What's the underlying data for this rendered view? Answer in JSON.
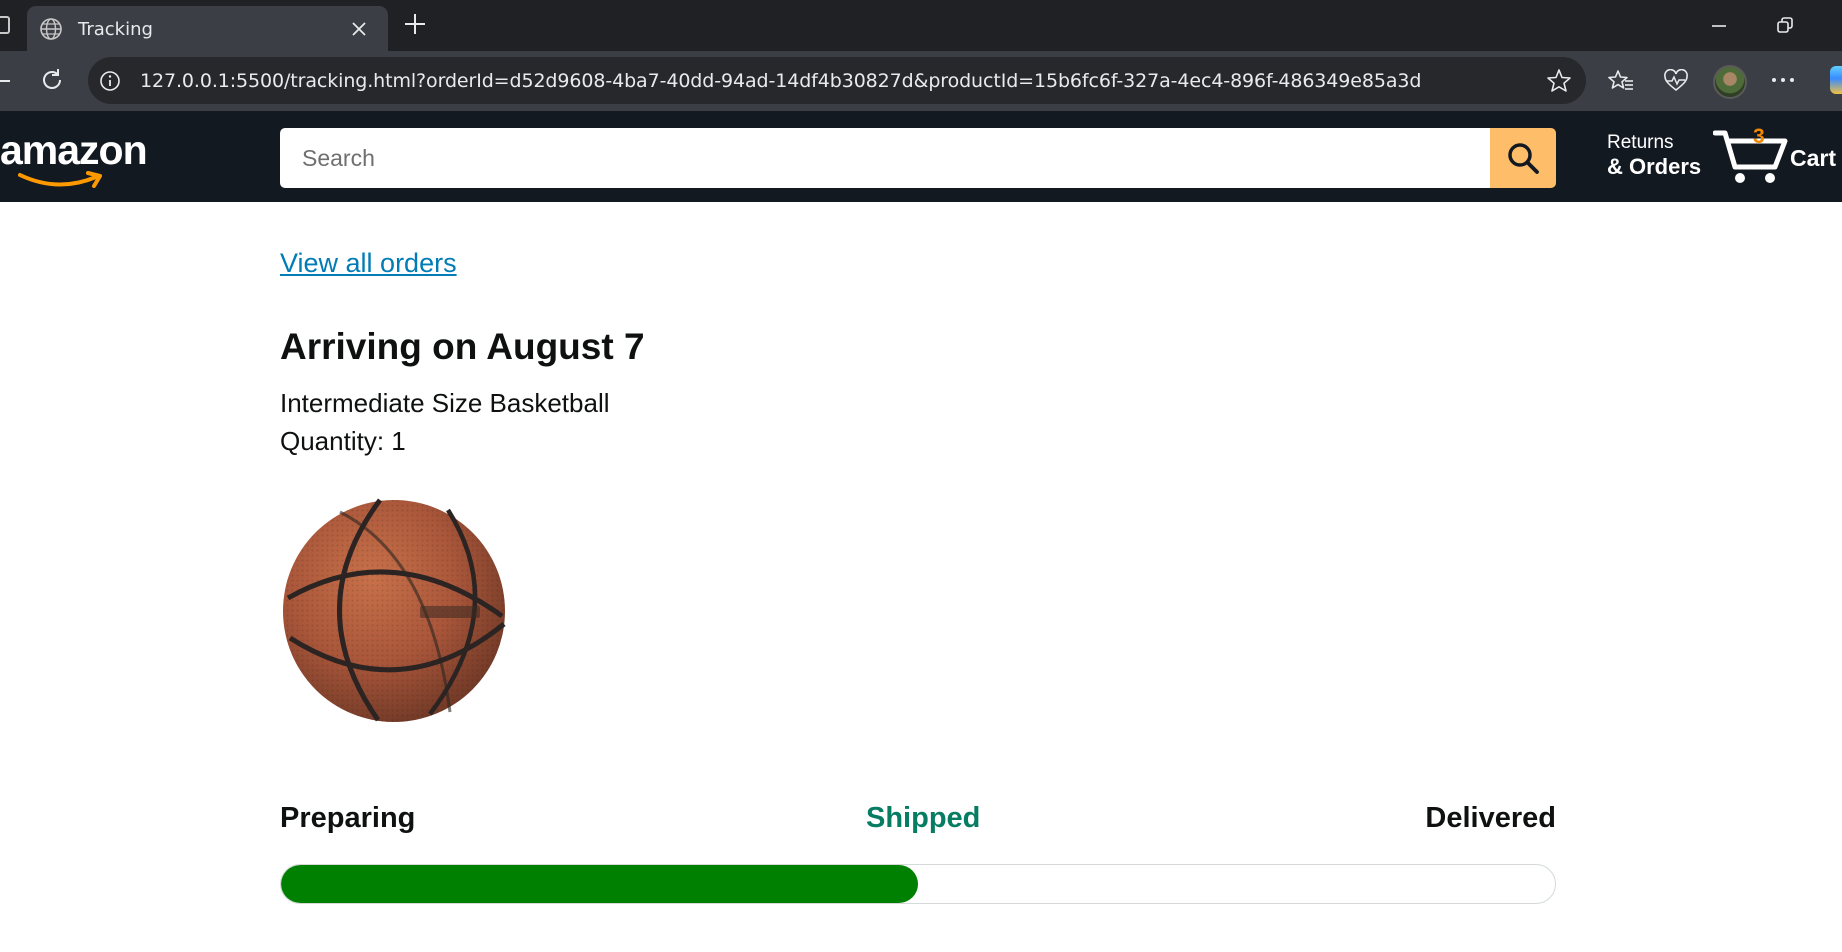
{
  "browser": {
    "tab_title": "Tracking",
    "url": "127.0.0.1:5500/tracking.html?orderId=d52d9608-4ba7-40dd-94ad-14df4b30827d&productId=15b6fc6f-327a-4ec4-896f-486349e85a3d"
  },
  "header": {
    "logo_text": "amazon",
    "search_placeholder": "Search",
    "returns_line1": "Returns",
    "returns_line2": "& Orders",
    "cart_count": "3",
    "cart_label": "Cart",
    "colors": {
      "header_bg": "#131921",
      "search_button": "#febd69",
      "cart_count": "#f08804"
    }
  },
  "main": {
    "view_orders_link": "View all orders",
    "arriving_heading": "Arriving on August 7",
    "product_name": "Intermediate Size Basketball",
    "quantity_text": "Quantity: 1",
    "product_image_icon": "basketball-image",
    "progress": {
      "labels": [
        "Preparing",
        "Shipped",
        "Delivered"
      ],
      "current_status": "Shipped",
      "fill_fraction": 0.5,
      "colors": {
        "fill": "#008000",
        "current_label": "#067d62"
      }
    }
  }
}
